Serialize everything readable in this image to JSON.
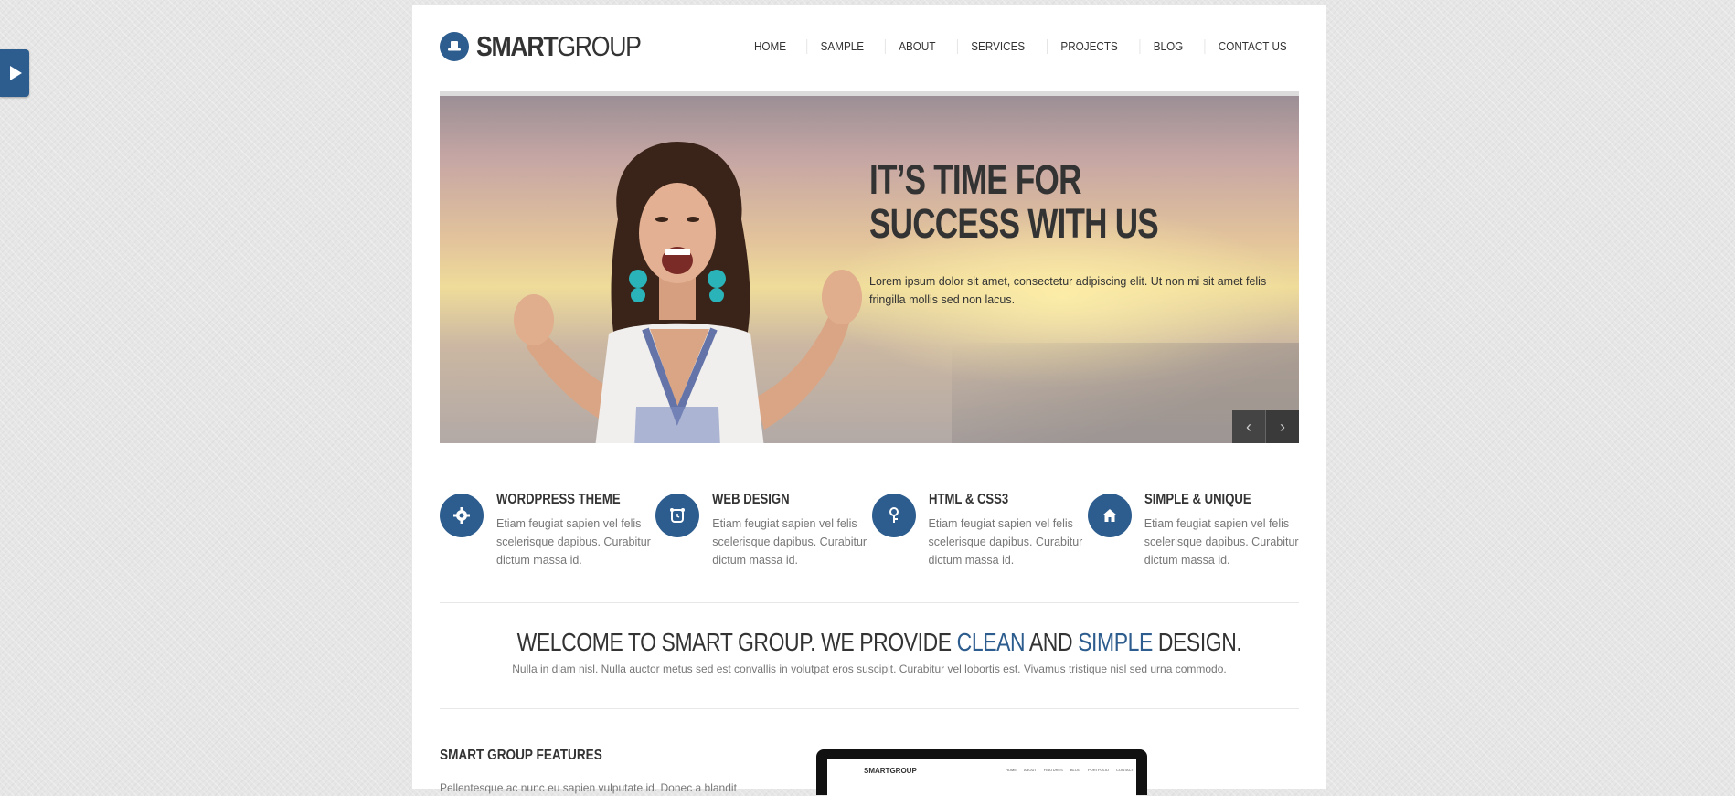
{
  "brand": {
    "bold": "SMART",
    "light": "GROUP",
    "accent_color": "#2d5d8e"
  },
  "nav": [
    "HOME",
    "SAMPLE",
    "ABOUT",
    "SERVICES",
    "PROJECTS",
    "BLOG",
    "CONTACT US"
  ],
  "hero": {
    "title_line1": "IT’S TIME FOR",
    "title_line2": "SUCCESS WITH US",
    "text": "Lorem ipsum dolor sit amet, consectetur adipiscing elit. Ut non mi sit amet felis fringilla mollis sed non lacus.",
    "prev_icon": "‹",
    "next_icon": "›"
  },
  "features": [
    {
      "icon": "gear-icon",
      "title": "WORDPRESS THEME",
      "text": "Etiam feugiat sapien vel felis scelerisque dapibus. Curabitur dictum massa id."
    },
    {
      "icon": "clock-icon",
      "title": "WEB DESIGN",
      "text": "Etiam feugiat sapien vel felis scelerisque dapibus. Curabitur dictum massa id."
    },
    {
      "icon": "key-icon",
      "title": "HTML & CSS3",
      "text": "Etiam feugiat sapien vel felis scelerisque dapibus. Curabitur dictum massa id."
    },
    {
      "icon": "home-icon",
      "title": "SIMPLE & UNIQUE",
      "text": "Etiam feugiat sapien vel felis scelerisque dapibus. Curabitur dictum massa id."
    }
  ],
  "welcome": {
    "part1": "WELCOME TO SMART GROUP. WE PROVIDE ",
    "highlight1": "CLEAN",
    "part2": " AND ",
    "highlight2": "SIMPLE",
    "part3": " DESIGN.",
    "subtext": "Nulla in diam nisl. Nulla auctor metus sed est convallis in volutpat eros suscipit. Curabitur vel lobortis est. Vivamus tristique nisl sed urna commodo."
  },
  "section": {
    "features_title": "SMART GROUP FEATURES",
    "features_text": "Pellentesque ac nunc eu sapien vulputate id. Donec a blandit"
  },
  "monitor": {
    "logo": "SMARTGROUP",
    "nav": [
      "HOME",
      "ABOUT",
      "FEATURES",
      "BLOG",
      "PORTFOLIO",
      "CONTACT"
    ]
  }
}
